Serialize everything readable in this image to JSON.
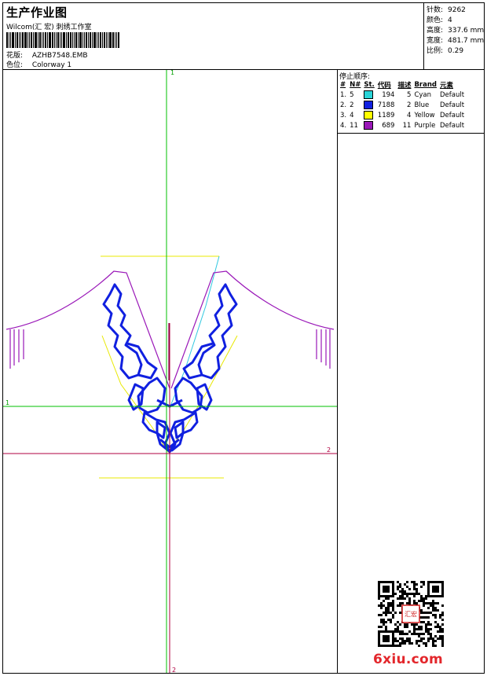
{
  "header": {
    "title": "生产作业图",
    "studio": "Wilcom(汇 宏) 刺绣工作室",
    "design_label": "花版:",
    "design_value": "AZHB7548.EMB",
    "colorway_label": "色位:",
    "colorway_value": "Colorway 1"
  },
  "stats": [
    {
      "label": "针数:",
      "value": "9262"
    },
    {
      "label": "颜色:",
      "value": "4"
    },
    {
      "label": "高度:",
      "value": "337.6 mm"
    },
    {
      "label": "宽度:",
      "value": "481.7 mm"
    },
    {
      "label": "比例:",
      "value": "0.29"
    }
  ],
  "stop_sequence": {
    "title": "停止顺序:",
    "columns": [
      "#",
      "N#",
      "St.",
      "代码",
      "描述",
      "Brand",
      "元素"
    ],
    "rows": [
      {
        "idx": "1.",
        "n": "5",
        "color": "#2ad4d8",
        "st": "194",
        "code": "5",
        "desc": "Cyan",
        "brand": "Default"
      },
      {
        "idx": "2.",
        "n": "2",
        "color": "#1020e0",
        "st": "7188",
        "code": "2",
        "desc": "Blue",
        "brand": "Default"
      },
      {
        "idx": "3.",
        "n": "4",
        "color": "#ffff00",
        "st": "1189",
        "code": "4",
        "desc": "Yellow",
        "brand": "Default"
      },
      {
        "idx": "4.",
        "n": "11",
        "color": "#9a18b8",
        "st": "689",
        "code": "11",
        "desc": "Purple",
        "brand": "Default"
      }
    ]
  },
  "canvas": {
    "axis_v_top": "1",
    "axis_v_bottom": "2",
    "axis_h_left": "1",
    "axis_h_right": "2"
  },
  "watermark": {
    "logo_text": "6xiu.com",
    "seal_text": "汇宏"
  }
}
